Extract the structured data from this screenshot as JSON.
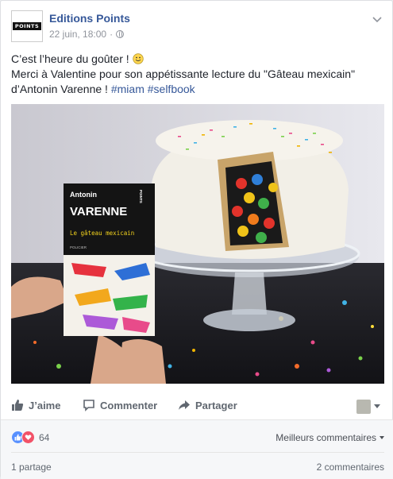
{
  "post": {
    "page_name": "Editions Points",
    "avatar_text": "POINTS",
    "date": "22 juin, 18:00",
    "separator": "·",
    "text_line1": "C’est l’heure du goûter ! ",
    "text_line2": "Merci à Valentine pour son appétissante lecture du \"Gâteau mexicain\"",
    "text_line3": "d’Antonin Varenne ! ",
    "hashtag1": "#miam",
    "hashtag2": "#selfbook",
    "emoji": "smile-emoji",
    "photo": {
      "book_author": "Antonin",
      "book_author_last": "VARENNE",
      "book_title": "Le gâteau mexicain",
      "book_publisher": "POINTS",
      "book_collection": "POLICIER"
    }
  },
  "actions": {
    "like": "J’aime",
    "comment": "Commenter",
    "share": "Partager"
  },
  "footer": {
    "reaction_count": "64",
    "best_comments": "Meilleurs commentaires",
    "shares": "1 partage",
    "comments": "2 commentaires"
  },
  "colors": {
    "link": "#365899",
    "like_blue": "#5890ff",
    "love_red": "#f25268",
    "muted": "#90949c"
  }
}
